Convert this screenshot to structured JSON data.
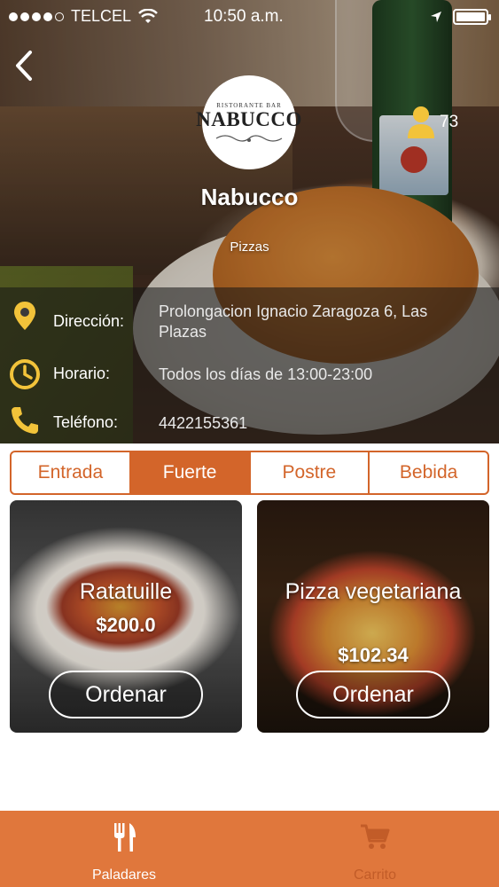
{
  "status_bar": {
    "carrier": "TELCEL",
    "time": "10:50 a.m."
  },
  "restaurant": {
    "logo_small_text": "RISTORANTE BAR",
    "logo_text": "NABUCCO",
    "name": "Nabucco",
    "category": "Pizzas",
    "followers_count": "73"
  },
  "info": {
    "address_label": "Dirección:",
    "address_value": "Prolongacion Ignacio Zaragoza 6, Las Plazas",
    "hours_label": "Horario:",
    "hours_value": "Todos los días de 13:00-23:00",
    "phone_label": "Teléfono:",
    "phone_value": "4422155361"
  },
  "tabs": [
    {
      "label": "Entrada",
      "active": false
    },
    {
      "label": "Fuerte",
      "active": true
    },
    {
      "label": "Postre",
      "active": false
    },
    {
      "label": "Bebida",
      "active": false
    }
  ],
  "dishes": [
    {
      "name": "Ratatuille",
      "price": "$200.0",
      "order_label": "Ordenar"
    },
    {
      "name": "Pizza vegetariana",
      "price": "$102.34",
      "order_label": "Ordenar"
    }
  ],
  "bottom_nav": [
    {
      "label": "Paladares",
      "icon": "fork-knife-icon",
      "active": true
    },
    {
      "label": "Carrito",
      "icon": "cart-icon",
      "active": false
    }
  ],
  "colors": {
    "accent": "#d3652a",
    "bottom_bar": "#e0773c",
    "location_icon": "#f2c33a"
  }
}
